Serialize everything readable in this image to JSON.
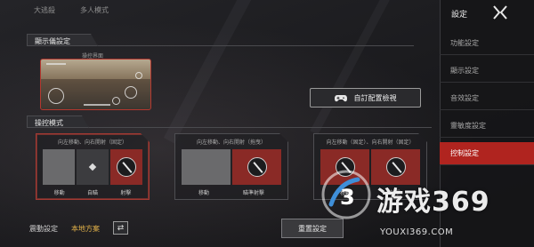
{
  "top_tabs": [
    "大逃殺",
    "多人模式"
  ],
  "sections": {
    "display": "顯示儀設定",
    "mode": "操控模式"
  },
  "preview_label": "操控界面",
  "custom_button": {
    "label": "自訂配置檢視",
    "icon": "gamepad-icon"
  },
  "modes": [
    {
      "title": "向左移動、向右開射（固定）",
      "labels": [
        "移動",
        "自瞄",
        "射擊"
      ],
      "selected": true
    },
    {
      "title": "向左移動、向右開射（拖曳）",
      "labels": [
        "移動",
        "瞄準射擊"
      ],
      "selected": false
    },
    {
      "title": "向左移動（固定）、向右開射（固定）",
      "labels": [
        "移動",
        "射擊"
      ],
      "selected": false
    }
  ],
  "vibration": {
    "label": "震動設定",
    "value": "本地方案",
    "swap_icon": "swap-icon"
  },
  "reset_button": "重置設定",
  "sidebar": {
    "title": "設定",
    "close_icon": "close-icon",
    "items": [
      "功能設定",
      "顯示設定",
      "音效設定",
      "靈敏度設定",
      "控制設定"
    ],
    "active_index": 4
  },
  "watermark": {
    "brand": "游戏369",
    "url": "YOUXI369.COM"
  },
  "colors": {
    "accent": "#b0241f",
    "highlight": "#e3b24a",
    "border_selected": "#a33a33"
  }
}
